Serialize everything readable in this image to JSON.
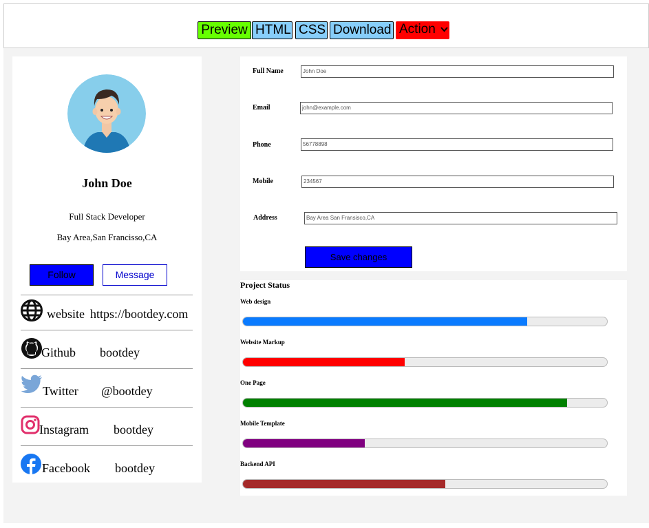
{
  "toolbar": {
    "preview": "Preview",
    "html": "HTML",
    "css": "CSS",
    "download": "Download",
    "action": "Action"
  },
  "profile": {
    "name": "John Doe",
    "role": "Full Stack Developer",
    "location": "Bay Area,San Francisso,CA",
    "follow": "Follow",
    "message": "Message"
  },
  "social": [
    {
      "label": "website",
      "value": "https://bootdey.com",
      "icon": "globe-icon"
    },
    {
      "label": "Github",
      "value": "bootdey",
      "icon": "github-icon"
    },
    {
      "label": "Twitter",
      "value": "@bootdey",
      "icon": "twitter-icon"
    },
    {
      "label": "Instagram",
      "value": "bootdey",
      "icon": "instagram-icon"
    },
    {
      "label": "Facebook",
      "value": "bootdey",
      "icon": "facebook-icon"
    }
  ],
  "form": {
    "full_name_label": "Full Name",
    "full_name_value": "John Doe",
    "email_label": "Email",
    "email_value": "john@example.com",
    "phone_label": "Phone",
    "phone_value": "56778898",
    "mobile_label": "Mobile",
    "mobile_value": "234567",
    "address_label": "Address",
    "address_value": "Bay Area San Fransisco,CA",
    "save": "Save changes"
  },
  "project_status": {
    "title": "Project Status",
    "items": [
      {
        "label": "Web design",
        "progress": 0.78,
        "color": "#0a7bff"
      },
      {
        "label": "Website Markup",
        "progress": 0.445,
        "color": "#ff0000"
      },
      {
        "label": "One Page",
        "progress": 0.89,
        "color": "#008000"
      },
      {
        "label": "Mobile Template",
        "progress": 0.335,
        "color": "#800080"
      },
      {
        "label": "Backend API",
        "progress": 0.555,
        "color": "#a52a2a"
      }
    ]
  }
}
